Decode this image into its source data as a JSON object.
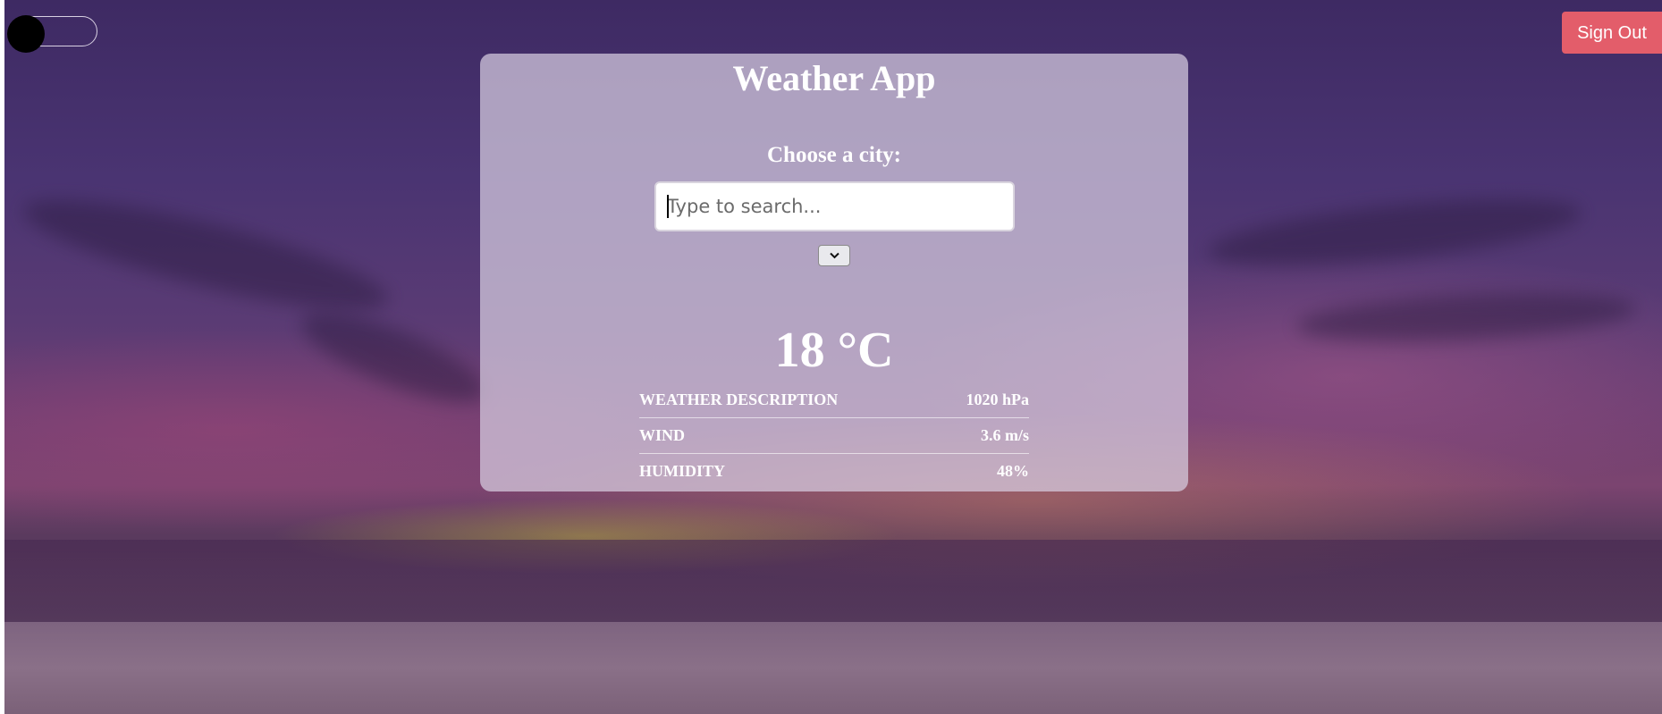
{
  "app": {
    "title": "Weather App",
    "sign_out_label": "Sign Out"
  },
  "search": {
    "label": "Choose a city:",
    "placeholder": "Type to search...",
    "value": ""
  },
  "dropdown": {
    "icon": "chevron-down-icon"
  },
  "weather": {
    "temperature": "18 °C",
    "rows": [
      {
        "label": "WEATHER DESCRIPTION",
        "value": "1020 hPa"
      },
      {
        "label": "WIND",
        "value": "3.6 m/s"
      },
      {
        "label": "HUMIDITY",
        "value": "48%"
      }
    ]
  },
  "theme_toggle": {
    "state": "off"
  },
  "colors": {
    "sign_out_bg": "#e35d6a",
    "card_bg": "rgba(215,205,225,0.72)",
    "text": "#ffffff"
  }
}
